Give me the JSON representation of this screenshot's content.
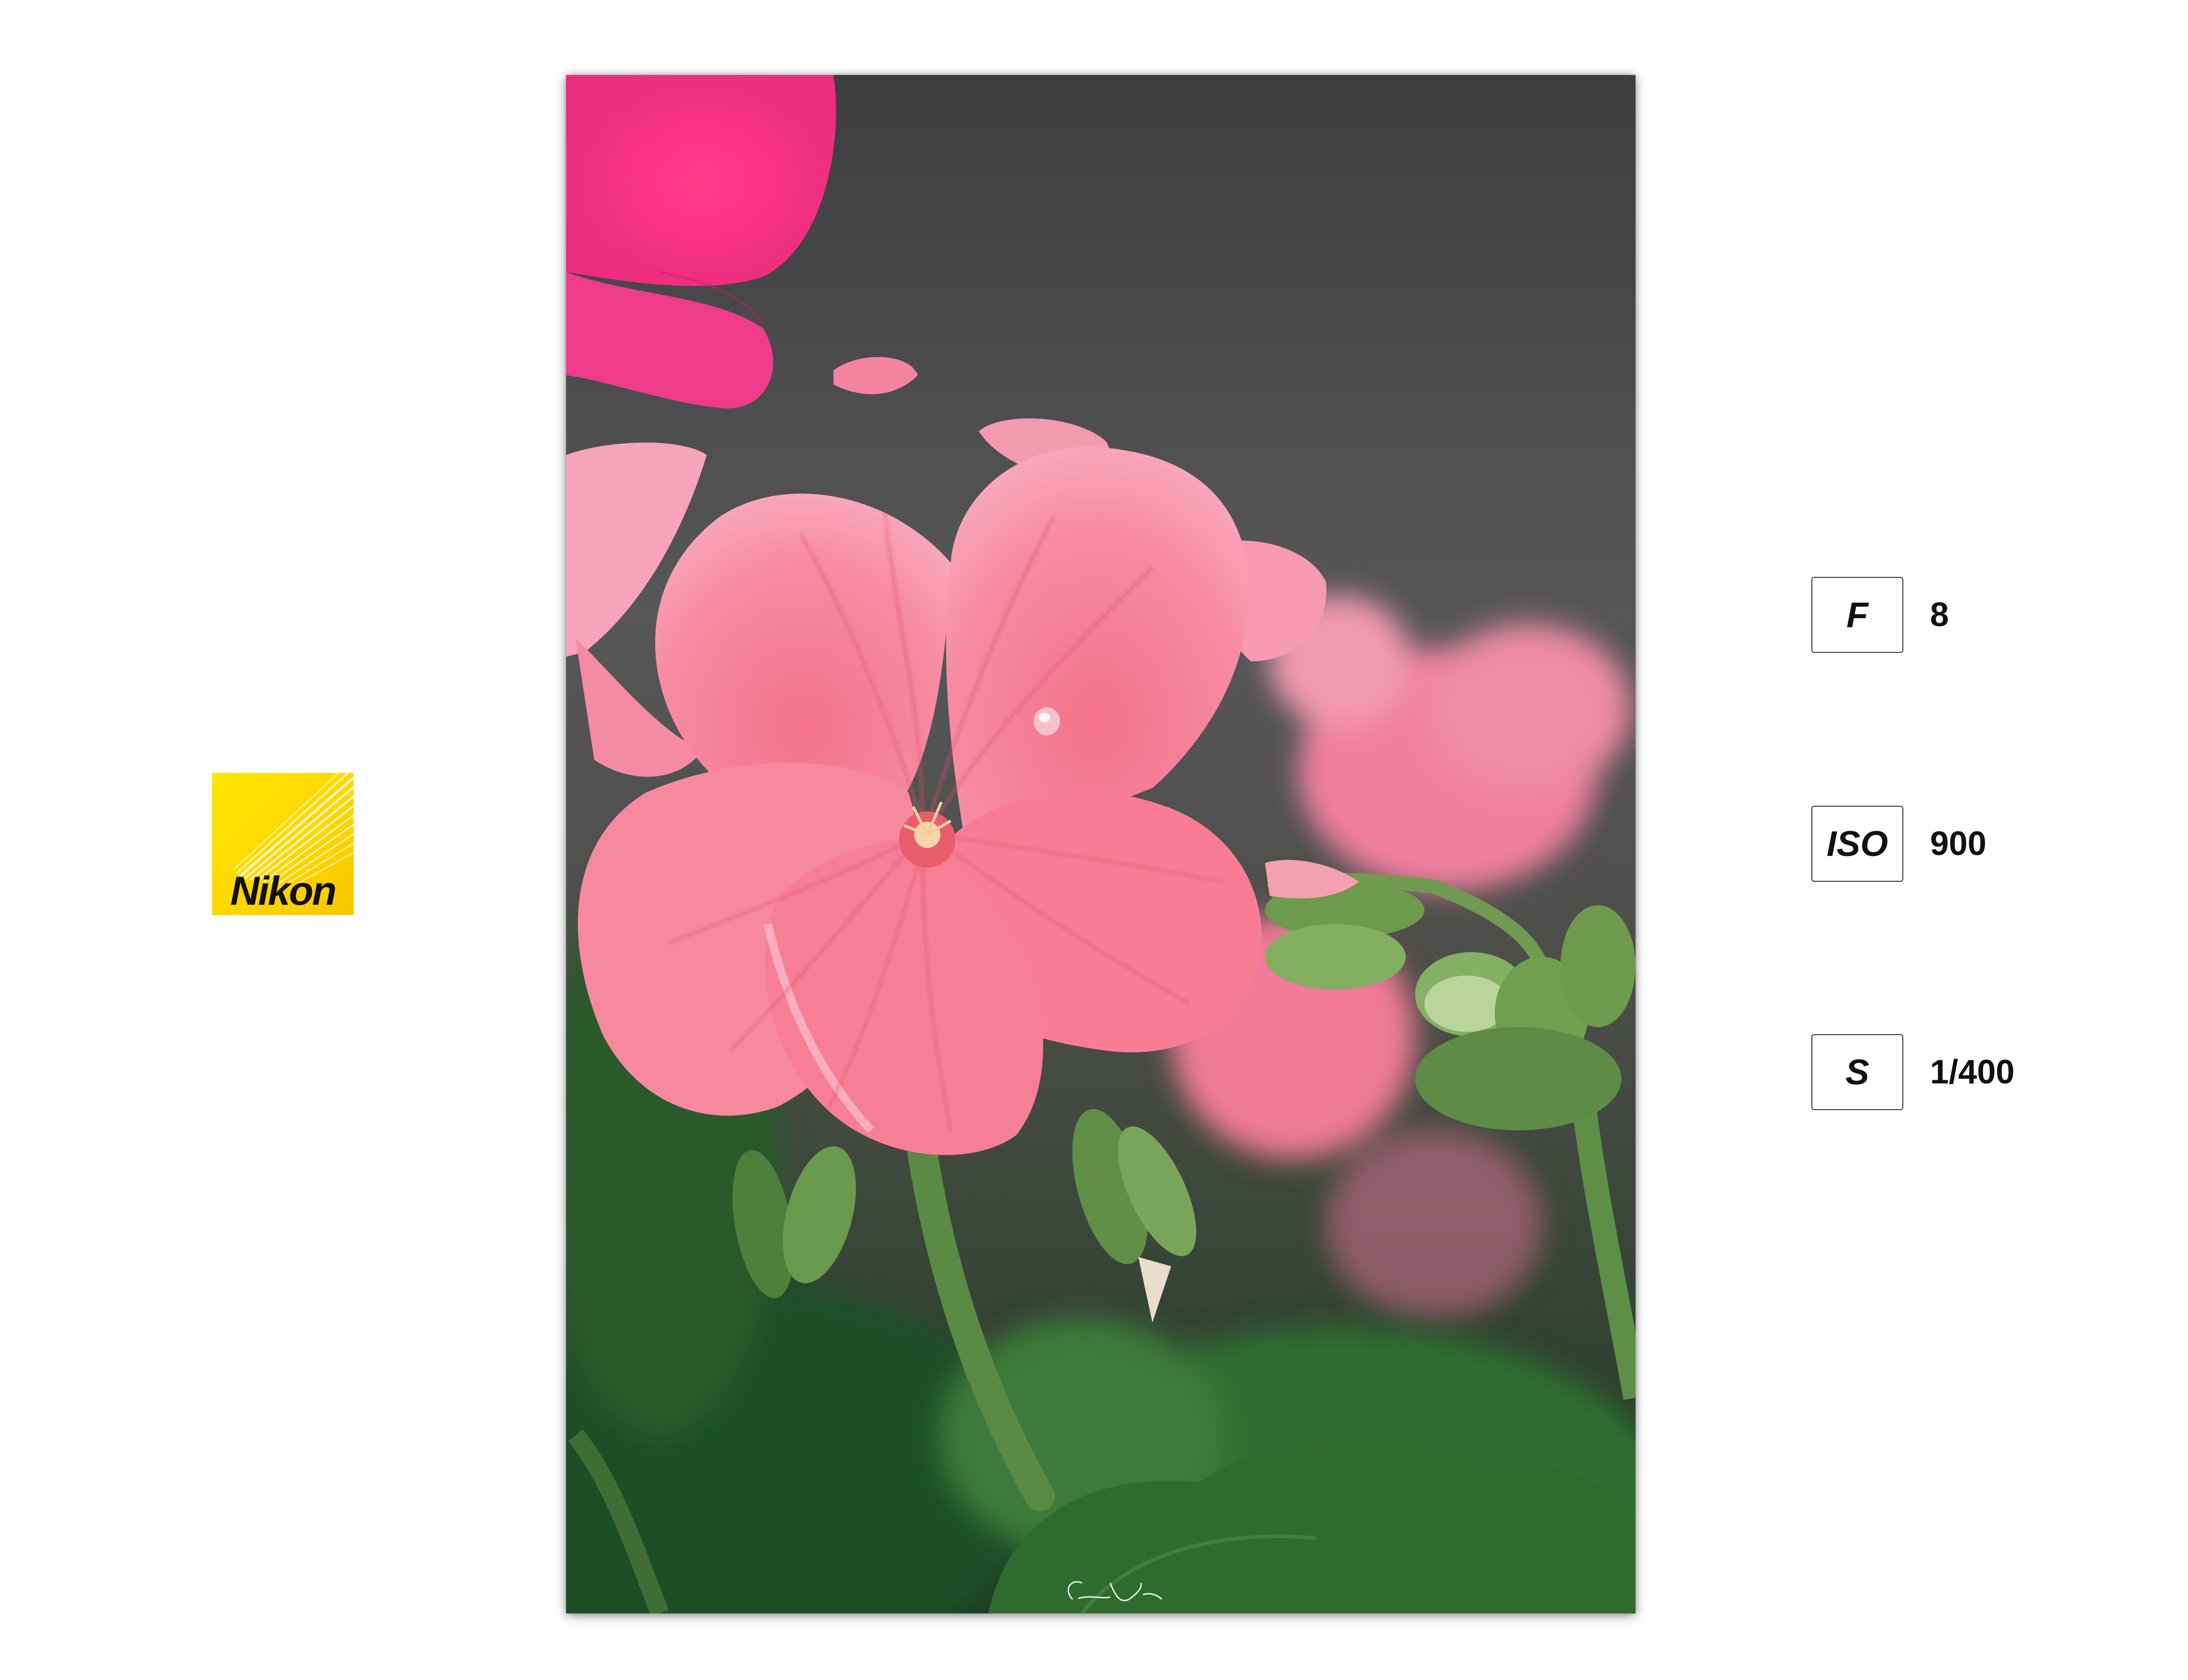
{
  "brand": {
    "logo_text": "Nikon",
    "colors": {
      "yellow": "#FFE100",
      "black": "#111111"
    }
  },
  "photo": {
    "subject": "pink-flower-photo",
    "signature_text": "C. Yang",
    "colors": {
      "petal": "#F47C98",
      "vein": "#E04A6A",
      "stem": "#5E8F45",
      "background": "#4A4A4E"
    }
  },
  "exif": {
    "items": [
      {
        "label": "F",
        "value": "8"
      },
      {
        "label": "ISO",
        "value": "900"
      },
      {
        "label": "S",
        "value": "1/400"
      }
    ]
  }
}
